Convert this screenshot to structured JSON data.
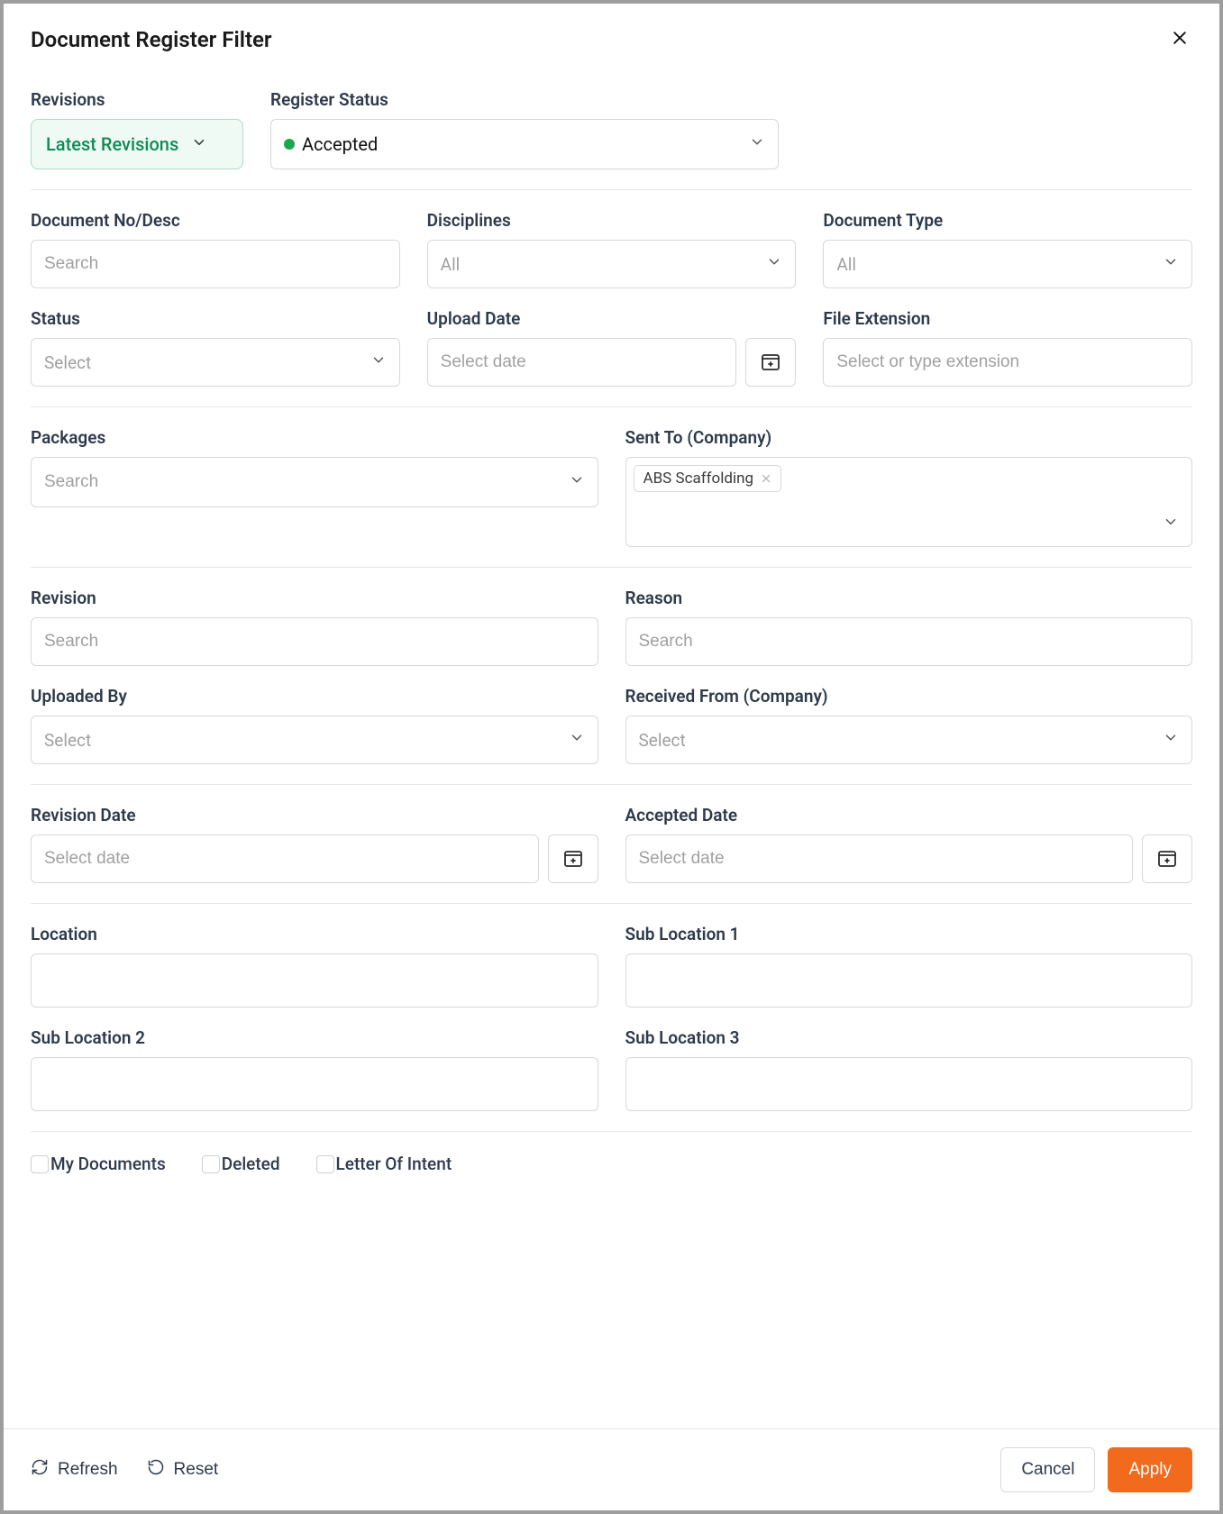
{
  "header": {
    "title": "Document Register Filter"
  },
  "section_top": {
    "revisions": {
      "label": "Revisions",
      "value": "Latest Revisions"
    },
    "register_status": {
      "label": "Register Status",
      "value": "Accepted",
      "dot_color": "#1aa94a"
    }
  },
  "section_docsearch": {
    "doc_no": {
      "label": "Document No/Desc",
      "placeholder": "Search"
    },
    "disciplines": {
      "label": "Disciplines",
      "placeholder": "All"
    },
    "doc_type": {
      "label": "Document Type",
      "placeholder": "All"
    },
    "status": {
      "label": "Status",
      "placeholder": "Select"
    },
    "upload_date": {
      "label": "Upload Date",
      "placeholder": "Select date"
    },
    "file_ext": {
      "label": "File Extension",
      "placeholder": "Select or type extension"
    }
  },
  "section_packages": {
    "packages": {
      "label": "Packages",
      "placeholder": "Search"
    },
    "sent_to": {
      "label": "Sent To (Company)",
      "tag": "ABS Scaffolding"
    }
  },
  "section_revision": {
    "revision": {
      "label": "Revision",
      "placeholder": "Search"
    },
    "reason": {
      "label": "Reason",
      "placeholder": "Search"
    },
    "uploaded_by": {
      "label": "Uploaded By",
      "placeholder": "Select"
    },
    "received_from": {
      "label": "Received From (Company)",
      "placeholder": "Select"
    }
  },
  "section_dates": {
    "revision_date": {
      "label": "Revision Date",
      "placeholder": "Select date"
    },
    "accepted_date": {
      "label": "Accepted Date",
      "placeholder": "Select date"
    }
  },
  "section_location": {
    "location": {
      "label": "Location"
    },
    "sub1": {
      "label": "Sub Location 1"
    },
    "sub2": {
      "label": "Sub Location 2"
    },
    "sub3": {
      "label": "Sub Location 3"
    }
  },
  "checks": {
    "my_docs": "My Documents",
    "deleted": "Deleted",
    "loi": "Letter Of Intent"
  },
  "footer": {
    "refresh": "Refresh",
    "reset": "Reset",
    "cancel": "Cancel",
    "apply": "Apply"
  }
}
